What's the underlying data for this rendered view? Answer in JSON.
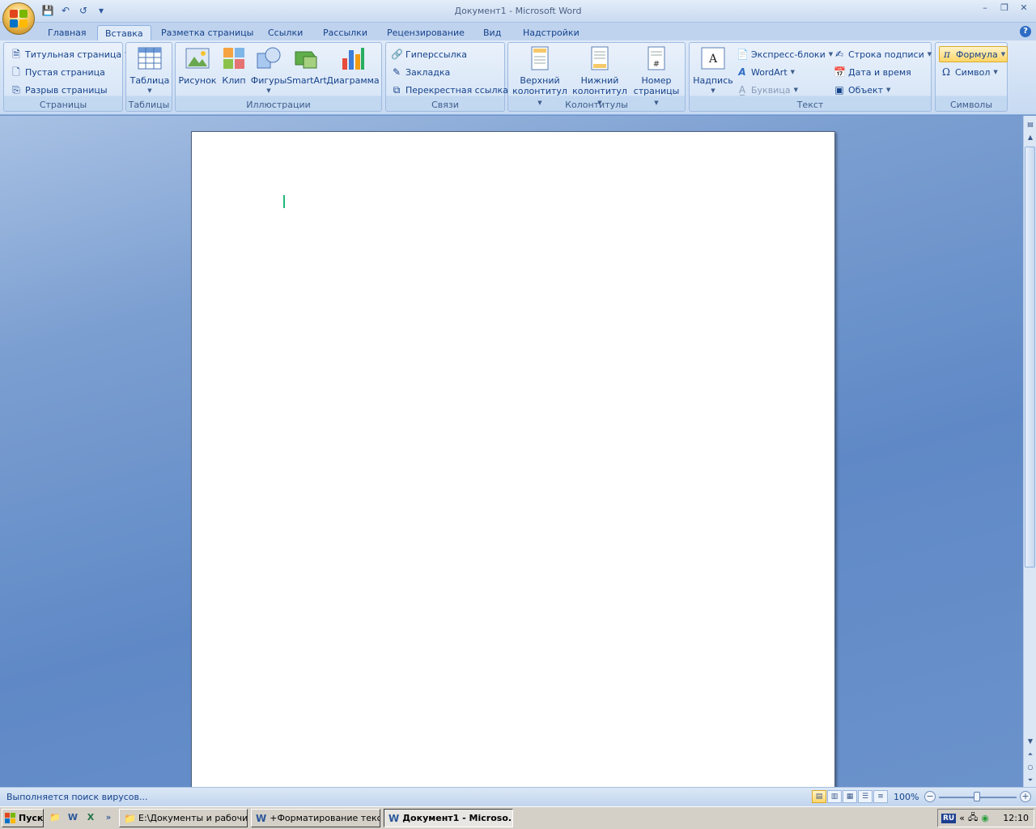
{
  "window": {
    "title": "Документ1 - Microsoft Word",
    "minimize": "–",
    "restore": "❐",
    "close": "✕"
  },
  "qat": {
    "save_icon": "💾",
    "undo_icon": "↶",
    "redo_icon": "↺",
    "more_icon": "▾"
  },
  "tabs": [
    {
      "label": "Главная"
    },
    {
      "label": "Вставка"
    },
    {
      "label": "Разметка страницы"
    },
    {
      "label": "Ссылки"
    },
    {
      "label": "Рассылки"
    },
    {
      "label": "Рецензирование"
    },
    {
      "label": "Вид"
    },
    {
      "label": "Надстройки"
    }
  ],
  "active_tab": "Вставка",
  "help_label": "?",
  "ribbon": {
    "pages": {
      "label": "Страницы",
      "cover": "Титульная страница",
      "blank": "Пустая страница",
      "break": "Разрыв страницы"
    },
    "tables": {
      "label": "Таблицы",
      "table": "Таблица"
    },
    "illustrations": {
      "label": "Иллюстрации",
      "picture": "Рисунок",
      "clip": "Клип",
      "shapes": "Фигуры",
      "smartart": "SmartArt",
      "chart": "Диаграмма"
    },
    "links": {
      "label": "Связи",
      "hyperlink": "Гиперссылка",
      "bookmark": "Закладка",
      "crossref": "Перекрестная ссылка"
    },
    "headers": {
      "label": "Колонтитулы",
      "header_line1": "Верхний",
      "header_line2": "колонтитул",
      "footer_line1": "Нижний",
      "footer_line2": "колонтитул",
      "pagenum_line1": "Номер",
      "pagenum_line2": "страницы"
    },
    "text": {
      "label": "Текст",
      "textbox": "Надпись",
      "quickparts": "Экспресс-блоки",
      "wordart": "WordArt",
      "dropcap": "Буквица",
      "signature": "Строка подписи",
      "datetime": "Дата и время",
      "object": "Объект"
    },
    "symbols": {
      "label": "Символы",
      "equation": "Формула",
      "symbol": "Символ"
    }
  },
  "status": {
    "text": "Выполняется поиск вирусов...",
    "zoom": "100%",
    "zoom_level_percent": 100
  },
  "taskbar": {
    "start": "Пуск",
    "tasks": [
      {
        "label": "E:\\Документы и рабочи..."
      },
      {
        "label": "+Форматирование текс..."
      },
      {
        "label": "Документ1 - Microso..."
      }
    ],
    "lang": "RU",
    "clock": "12:10"
  },
  "colors": {
    "accent": "#15428b",
    "ribbon_bg": "#dfeaf8",
    "doc_bg": "#6f93c7",
    "cursor": "#1fb87a"
  }
}
